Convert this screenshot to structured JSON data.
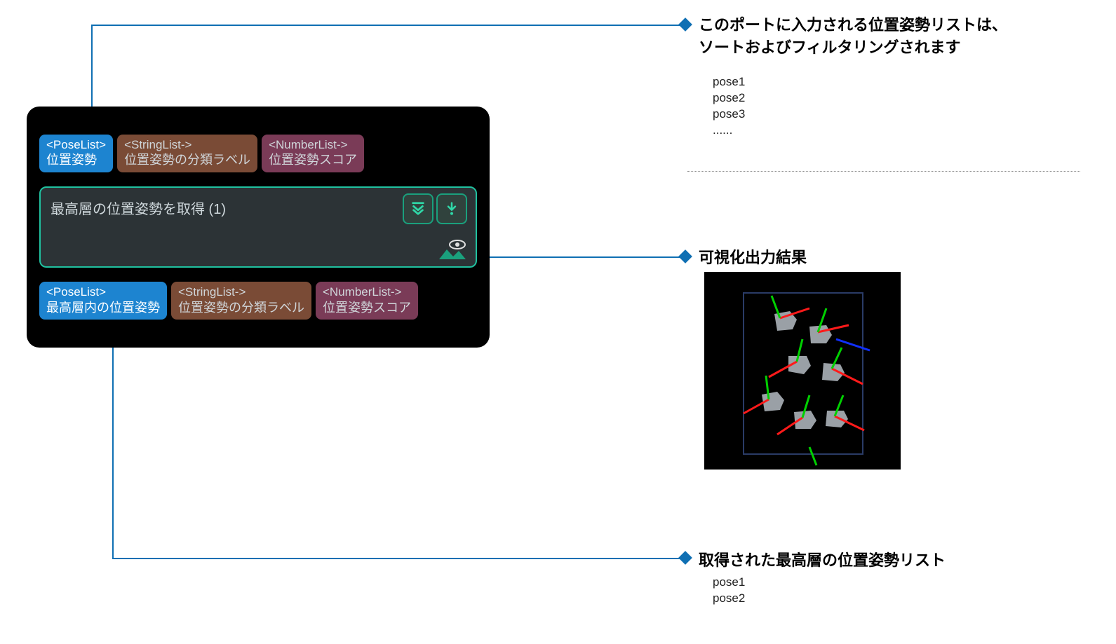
{
  "colors": {
    "accent_line": "#0f6fb3",
    "step_border": "#20c2a0",
    "port_blue": "#1d84d0",
    "port_brown": "#7a4b36",
    "port_plum": "#7a3b57"
  },
  "node": {
    "inputs": [
      {
        "type": "<PoseList>",
        "label": "位置姿勢",
        "color": "blue"
      },
      {
        "type": "<StringList->",
        "label": "位置姿勢の分類ラベル",
        "color": "brown"
      },
      {
        "type": "<NumberList->",
        "label": "位置姿勢スコア",
        "color": "plum"
      }
    ],
    "outputs": [
      {
        "type": "<PoseList>",
        "label": "最高層内の位置姿勢",
        "color": "blue"
      },
      {
        "type": "<StringList->",
        "label": "位置姿勢の分類ラベル",
        "color": "brown"
      },
      {
        "type": "<NumberList->",
        "label": "位置姿勢スコア",
        "color": "plum"
      }
    ],
    "step_title": "最高層の位置姿勢を取得 (1)"
  },
  "callouts": {
    "top": {
      "title_line1": "このポートに入力される位置姿勢リストは、",
      "title_line2": "ソートおよびフィルタリングされます",
      "body": "pose1\npose2\npose3\n......"
    },
    "mid": {
      "title": "可視化出力結果"
    },
    "bot": {
      "title": "取得された最高層の位置姿勢リスト",
      "body": "pose1\npose2"
    }
  },
  "icons": {
    "btn1": "double-down-icon",
    "btn2": "download-arrow-icon",
    "vis": "visualize-output-icon"
  }
}
